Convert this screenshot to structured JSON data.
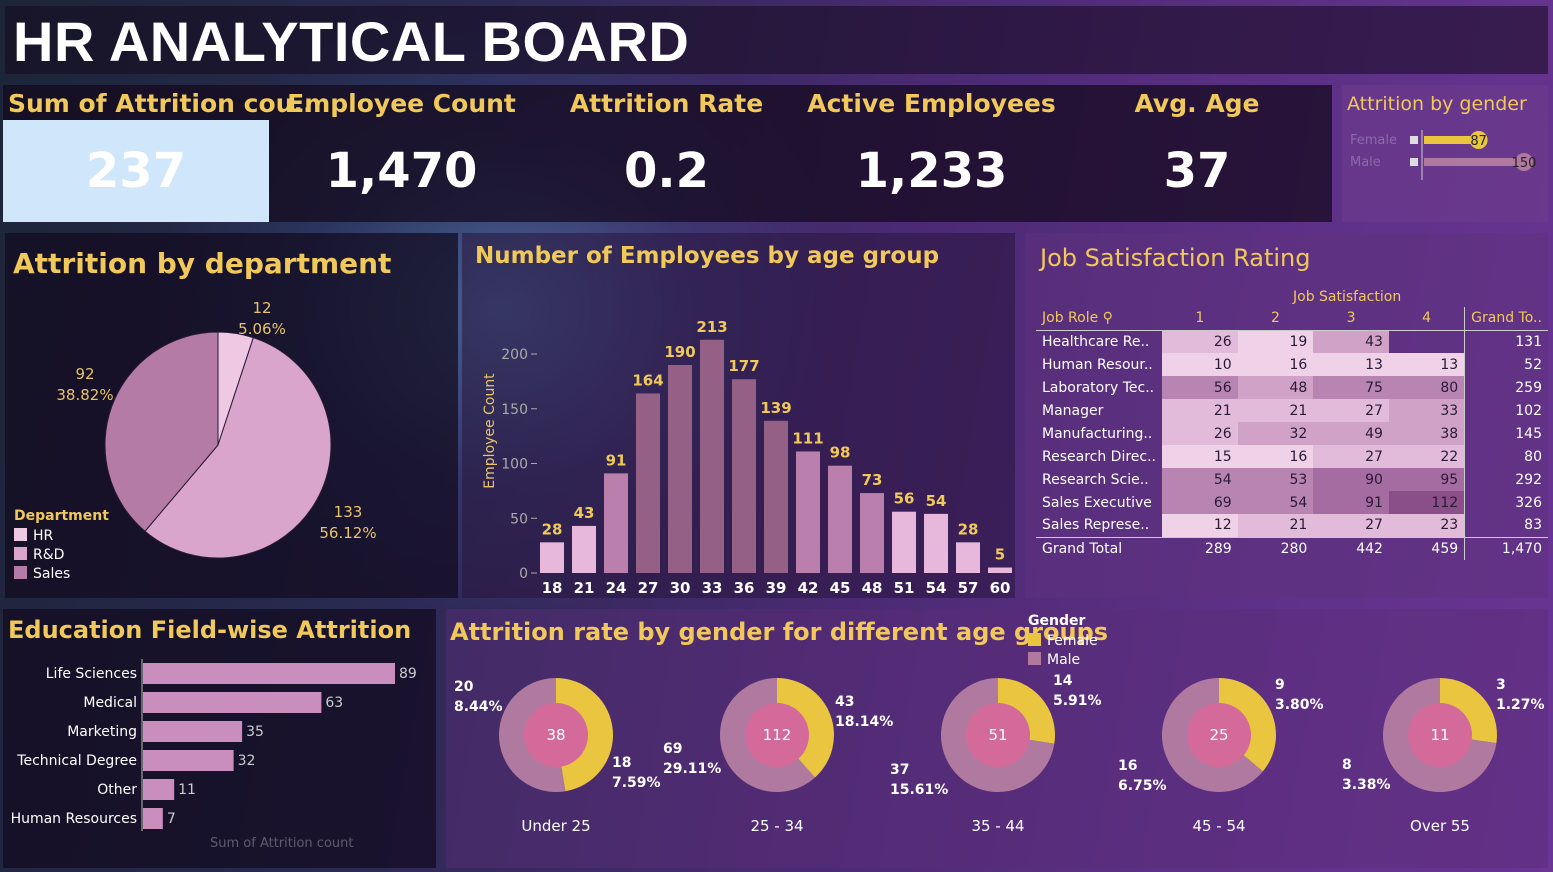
{
  "title": "HR ANALYTICAL BOARD",
  "kpis": [
    {
      "label": "Sum of Attrition cou..",
      "value": "237"
    },
    {
      "label": "Employee Count",
      "value": "1,470"
    },
    {
      "label": "Attrition Rate",
      "value": "0.2"
    },
    {
      "label": "Active Employees",
      "value": "1,233"
    },
    {
      "label": "Avg. Age",
      "value": "37"
    }
  ],
  "attrition_by_gender": {
    "title": "Attrition by gender",
    "rows": [
      {
        "label": "Female",
        "value": 87,
        "value_text": "87"
      },
      {
        "label": "Male",
        "value": 150,
        "value_text": "150"
      }
    ],
    "colors": {
      "Female": "#eac640",
      "Male": "#b07aa0"
    }
  },
  "attrition_by_department": {
    "title": "Attrition by department",
    "legend_title": "Department",
    "slices": [
      {
        "name": "HR",
        "value": 12,
        "count_text": "12",
        "pct_text": "5.06%",
        "color": "#efc9e3"
      },
      {
        "name": "R&D",
        "value": 133,
        "count_text": "133",
        "pct_text": "56.12%",
        "color": "#d9a5cc"
      },
      {
        "name": "Sales",
        "value": 92,
        "count_text": "92",
        "pct_text": "38.82%",
        "color": "#b57ba7"
      }
    ]
  },
  "age_group": {
    "title": "Number of Employees by age group",
    "ylabel": "Employee Count",
    "yticks": [
      "200",
      "150",
      "100",
      "50",
      "0"
    ],
    "categories": [
      "18",
      "21",
      "24",
      "27",
      "30",
      "33",
      "36",
      "39",
      "42",
      "45",
      "48",
      "51",
      "54",
      "57",
      "60"
    ],
    "values": [
      28,
      43,
      91,
      164,
      190,
      213,
      177,
      139,
      111,
      98,
      73,
      56,
      54,
      28,
      5
    ]
  },
  "job_satisfaction": {
    "title": "Job Satisfaction Rating",
    "col_group_label": "Job Satisfaction",
    "row_header": "Job Role",
    "columns": [
      "1",
      "2",
      "3",
      "4",
      "Grand To.."
    ],
    "rows": [
      {
        "role": "Healthcare Re..",
        "values": [
          "26",
          "19",
          "43",
          ""
        ],
        "total": "131"
      },
      {
        "role": "Human Resour..",
        "values": [
          "10",
          "16",
          "13",
          "13"
        ],
        "total": "52"
      },
      {
        "role": "Laboratory Tec..",
        "values": [
          "56",
          "48",
          "75",
          "80"
        ],
        "total": "259"
      },
      {
        "role": "Manager",
        "values": [
          "21",
          "21",
          "27",
          "33"
        ],
        "total": "102"
      },
      {
        "role": "Manufacturing..",
        "values": [
          "26",
          "32",
          "49",
          "38"
        ],
        "total": "145"
      },
      {
        "role": "Research Direc..",
        "values": [
          "15",
          "16",
          "27",
          "22"
        ],
        "total": "80"
      },
      {
        "role": "Research Scie..",
        "values": [
          "54",
          "53",
          "90",
          "95"
        ],
        "total": "292"
      },
      {
        "role": "Sales Executive",
        "values": [
          "69",
          "54",
          "91",
          "112"
        ],
        "total": "326"
      },
      {
        "role": "Sales Represe..",
        "values": [
          "12",
          "21",
          "27",
          "23"
        ],
        "total": "83"
      }
    ],
    "grand_total": {
      "role": "Grand Total",
      "values": [
        "289",
        "280",
        "442",
        "459"
      ],
      "total": "1,470"
    }
  },
  "education": {
    "title": "Education Field-wise Attrition",
    "xlabel": "Sum of Attrition count",
    "categories": [
      "Life Sciences",
      "Medical",
      "Marketing",
      "Technical Degree",
      "Other",
      "Human Resources"
    ],
    "values": [
      89,
      63,
      35,
      32,
      11,
      7
    ]
  },
  "gender_age": {
    "title": "Attrition rate by gender for different age groups",
    "legend_title": "Gender",
    "legend": [
      "Female",
      "Male"
    ],
    "groups": [
      {
        "name": "Under 25",
        "total": "38",
        "female": 18,
        "male": 20,
        "female_text": [
          "18",
          "7.59%"
        ],
        "male_text": [
          "20",
          "8.44%"
        ]
      },
      {
        "name": "25 - 34",
        "total": "112",
        "female": 43,
        "male": 69,
        "female_text": [
          "43",
          "18.14%"
        ],
        "male_text": [
          "69",
          "29.11%"
        ]
      },
      {
        "name": "35 - 44",
        "total": "51",
        "female": 14,
        "male": 37,
        "female_text": [
          "14",
          "5.91%"
        ],
        "male_text": [
          "37",
          "15.61%"
        ]
      },
      {
        "name": "45 - 54",
        "total": "25",
        "female": 9,
        "male": 16,
        "female_text": [
          "9",
          "3.80%"
        ],
        "male_text": [
          "16",
          "6.75%"
        ]
      },
      {
        "name": "Over 55",
        "total": "11",
        "female": 3,
        "male": 8,
        "female_text": [
          "3",
          "1.27%"
        ],
        "male_text": [
          "8",
          "3.38%"
        ]
      }
    ]
  },
  "chart_data": [
    {
      "type": "pie",
      "title": "Attrition by department",
      "categories": [
        "HR",
        "R&D",
        "Sales"
      ],
      "values": [
        12,
        133,
        92
      ],
      "legend": "bottom-left"
    },
    {
      "type": "bar",
      "title": "Number of Employees by age group",
      "categories": [
        "18",
        "21",
        "24",
        "27",
        "30",
        "33",
        "36",
        "39",
        "42",
        "45",
        "48",
        "51",
        "54",
        "57",
        "60"
      ],
      "values": [
        28,
        43,
        91,
        164,
        190,
        213,
        177,
        139,
        111,
        98,
        73,
        56,
        54,
        28,
        5
      ],
      "ylabel": "Employee Count",
      "ylim": [
        0,
        220
      ]
    },
    {
      "type": "table",
      "title": "Job Satisfaction Rating",
      "columns": [
        "Job Role",
        "1",
        "2",
        "3",
        "4",
        "Grand To.."
      ]
    },
    {
      "type": "bar",
      "title": "Education Field-wise Attrition",
      "categories": [
        "Life Sciences",
        "Medical",
        "Marketing",
        "Technical Degree",
        "Other",
        "Human Resources"
      ],
      "values": [
        89,
        63,
        35,
        32,
        11,
        7
      ],
      "xlabel": "Sum of Attrition count"
    },
    {
      "type": "pie",
      "title": "Attrition rate by gender for different age groups",
      "categories": [
        "Under 25",
        "25 - 34",
        "35 - 44",
        "45 - 54",
        "Over 55"
      ],
      "series": [
        {
          "name": "Female",
          "values": [
            18,
            43,
            14,
            9,
            3
          ]
        },
        {
          "name": "Male",
          "values": [
            20,
            69,
            37,
            16,
            8
          ]
        }
      ]
    },
    {
      "type": "bar",
      "title": "Attrition by gender",
      "categories": [
        "Female",
        "Male"
      ],
      "values": [
        87,
        150
      ]
    }
  ]
}
